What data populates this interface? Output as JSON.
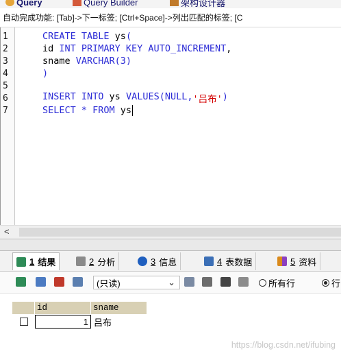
{
  "tabs": [
    {
      "label": "Query",
      "icon": "query-icon",
      "active": true
    },
    {
      "label": "Query Builder",
      "icon": "query-builder-icon"
    },
    {
      "label": "架构设计器",
      "icon": "schema-designer-icon"
    }
  ],
  "hint": "自动完成功能: [Tab]->下一标签; [Ctrl+Space]->列出匹配的标签; [C",
  "editor": {
    "lines": [
      {
        "n": "1",
        "parts": [
          {
            "t": "CREATE TABLE ",
            "c": "kw"
          },
          {
            "t": "ys",
            "c": "plain"
          },
          {
            "t": "(",
            "c": "kw"
          }
        ]
      },
      {
        "n": "2",
        "parts": [
          {
            "t": "id ",
            "c": "plain"
          },
          {
            "t": "INT PRIMARY KEY AUTO_INCREMENT",
            "c": "kw"
          },
          {
            "t": ",",
            "c": "plain"
          }
        ]
      },
      {
        "n": "3",
        "parts": [
          {
            "t": "sname ",
            "c": "plain"
          },
          {
            "t": "VARCHAR(3)",
            "c": "kw"
          }
        ]
      },
      {
        "n": "4",
        "parts": [
          {
            "t": ")",
            "c": "kw"
          }
        ]
      },
      {
        "n": "5",
        "parts": []
      },
      {
        "n": "6",
        "parts": [
          {
            "t": "INSERT INTO ",
            "c": "kw"
          },
          {
            "t": "ys ",
            "c": "plain"
          },
          {
            "t": "VALUES(NULL,",
            "c": "kw"
          },
          {
            "t": "'吕布'",
            "c": "str"
          },
          {
            "t": ")",
            "c": "kw"
          }
        ]
      },
      {
        "n": "7",
        "parts": [
          {
            "t": "SELECT * FROM ",
            "c": "kw"
          },
          {
            "t": "ys",
            "c": "plain"
          }
        ]
      }
    ]
  },
  "scroll_left_glyph": "<",
  "result_tabs": [
    {
      "num": "1",
      "label": "结果",
      "icon": "grid-icon",
      "color": "#2e8b57",
      "active": true
    },
    {
      "num": "2",
      "label": "分析",
      "icon": "profile-icon",
      "color": "#6b6b6b"
    },
    {
      "num": "3",
      "label": "信息",
      "icon": "info-icon",
      "color": "#1f5fbf"
    },
    {
      "num": "4",
      "label": "表数据",
      "icon": "table-data-icon",
      "color": "#3b6fb6"
    },
    {
      "num": "5",
      "label": "资料",
      "icon": "info-chart-icon",
      "color": "#d98a1c"
    }
  ],
  "toolbar": {
    "readonly_label": "(只读)",
    "radio_all": "所有行",
    "radio_partial": "行"
  },
  "grid": {
    "columns": [
      "id",
      "sname"
    ],
    "rows": [
      {
        "id": "1",
        "sname": "吕布"
      }
    ]
  },
  "watermark": "https://blog.csdn.net/ifubing"
}
